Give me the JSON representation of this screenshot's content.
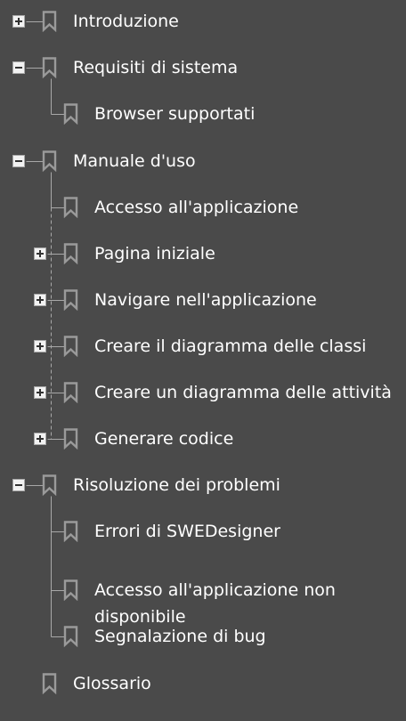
{
  "outline": {
    "items": [
      {
        "id": "introduzione",
        "label": "Introduzione",
        "level": 0,
        "state": "collapsed"
      },
      {
        "id": "requisiti",
        "label": "Requisiti di sistema",
        "level": 0,
        "state": "expanded"
      },
      {
        "id": "browser",
        "label": "Browser supportati",
        "level": 1,
        "state": "leaf"
      },
      {
        "id": "manuale",
        "label": "Manuale d'uso",
        "level": 0,
        "state": "expanded"
      },
      {
        "id": "accesso",
        "label": "Accesso all'applicazione",
        "level": 1,
        "state": "leaf"
      },
      {
        "id": "pagina",
        "label": "Pagina iniziale",
        "level": 1,
        "state": "collapsed"
      },
      {
        "id": "navigare",
        "label": "Navigare nell'applicazione",
        "level": 1,
        "state": "collapsed"
      },
      {
        "id": "classi",
        "label": "Creare il diagramma delle classi",
        "level": 1,
        "state": "collapsed"
      },
      {
        "id": "attivita",
        "label": "Creare un diagramma delle attività",
        "level": 1,
        "state": "collapsed"
      },
      {
        "id": "codice",
        "label": "Generare codice",
        "level": 1,
        "state": "collapsed"
      },
      {
        "id": "risoluzione",
        "label": "Risoluzione dei problemi",
        "level": 0,
        "state": "expanded"
      },
      {
        "id": "errori",
        "label": "Errori di SWEDesigner",
        "level": 1,
        "state": "leaf"
      },
      {
        "id": "nondisp",
        "label": "Accesso all'applicazione non disponibile",
        "level": 1,
        "state": "leaf"
      },
      {
        "id": "bug",
        "label": "Segnalazione di bug",
        "level": 1,
        "state": "leaf"
      },
      {
        "id": "glossario",
        "label": "Glossario",
        "level": 0,
        "state": "leaf"
      }
    ]
  },
  "colors": {
    "background": "#4a4a4a",
    "text": "#ffffff",
    "tree_line": "#a8a8a8",
    "bookmark_icon": "#9a9a9a",
    "toggle_box": "#f2f2f2"
  }
}
